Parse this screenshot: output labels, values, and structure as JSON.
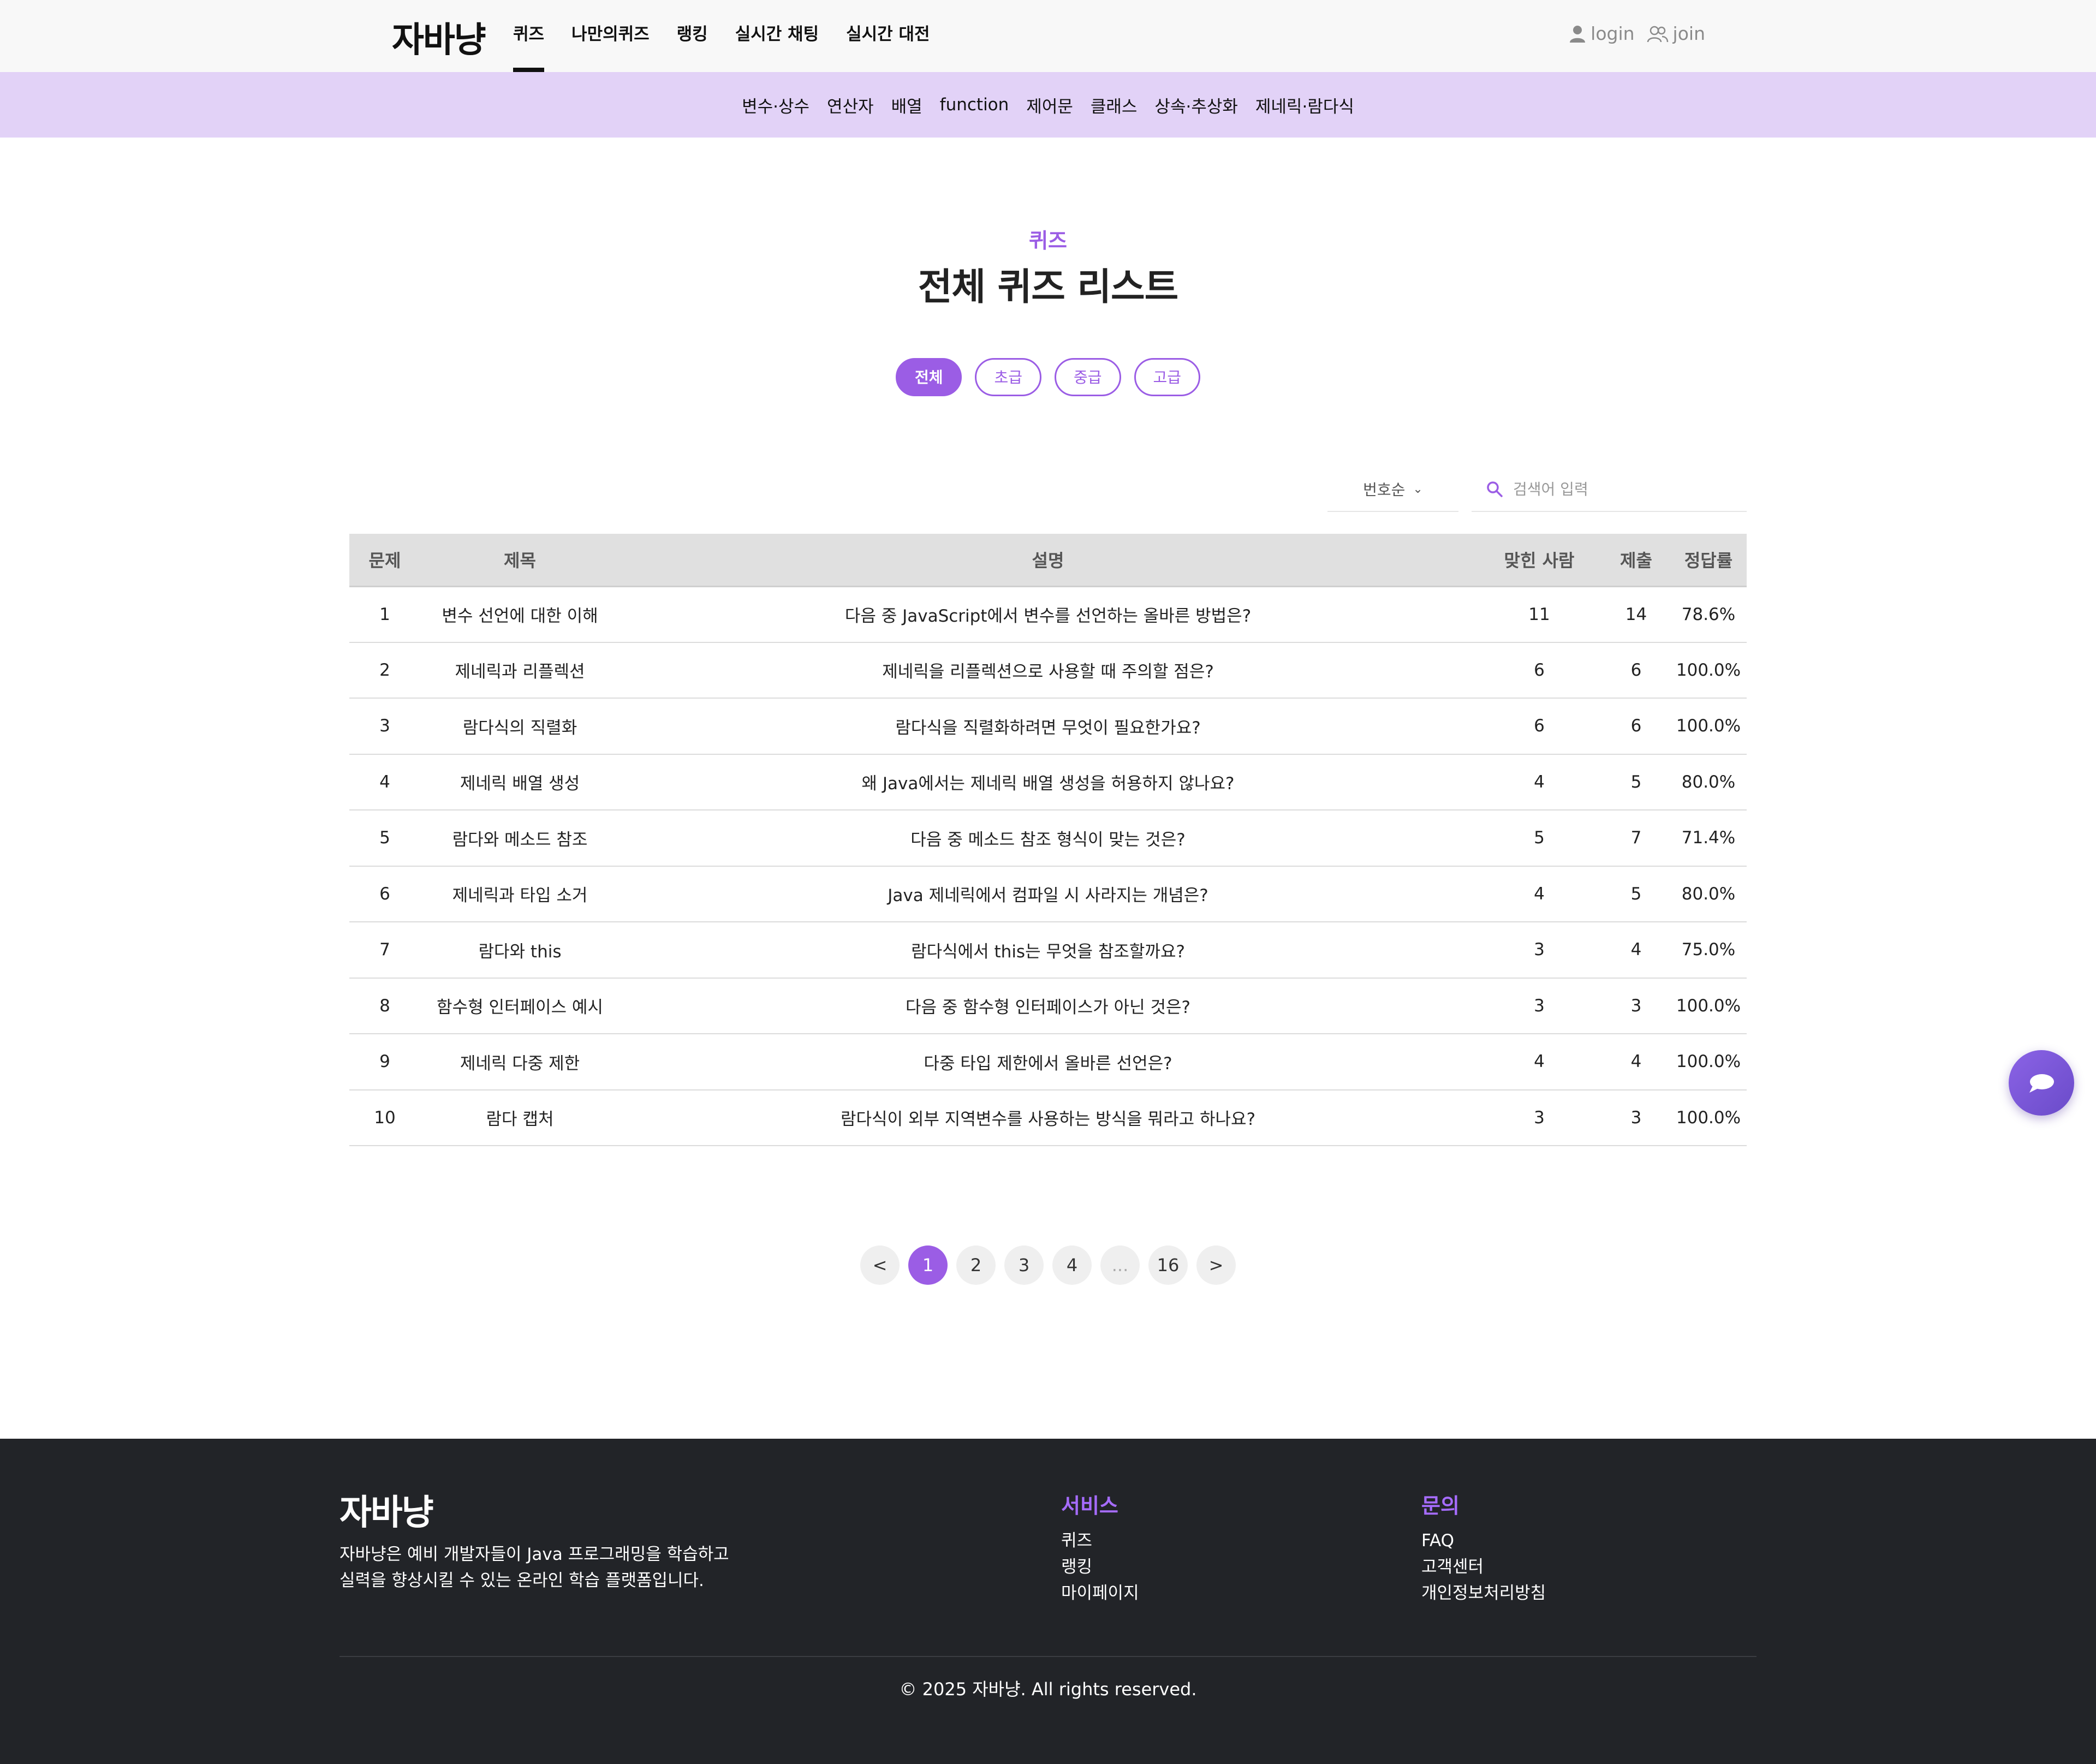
{
  "header": {
    "logo": "자바냥",
    "nav": [
      "퀴즈",
      "나만의퀴즈",
      "랭킹",
      "실시간 채팅",
      "실시간 대전"
    ],
    "login_label": "login",
    "join_label": "join"
  },
  "subnav": [
    "변수·상수",
    "연산자",
    "배열",
    "function",
    "제어문",
    "클래스",
    "상속·추상화",
    "제네릭·람다식"
  ],
  "hero": {
    "eyebrow": "퀴즈",
    "title": "전체 퀴즈 리스트"
  },
  "levels": [
    "전체",
    "초급",
    "중급",
    "고급"
  ],
  "controls": {
    "sort_label": "번호순",
    "search_placeholder": "검색어 입력"
  },
  "table": {
    "headers": [
      "문제",
      "제목",
      "설명",
      "맞힌 사람",
      "제출",
      "정답률"
    ],
    "rows": [
      [
        "1",
        "변수 선언에 대한 이해",
        "다음 중 JavaScript에서 변수를 선언하는 올바른 방법은?",
        "11",
        "14",
        "78.6%"
      ],
      [
        "2",
        "제네릭과 리플렉션",
        "제네릭을 리플렉션으로 사용할 때 주의할 점은?",
        "6",
        "6",
        "100.0%"
      ],
      [
        "3",
        "람다식의 직렬화",
        "람다식을 직렬화하려면 무엇이 필요한가요?",
        "6",
        "6",
        "100.0%"
      ],
      [
        "4",
        "제네릭 배열 생성",
        "왜 Java에서는 제네릭 배열 생성을 허용하지 않나요?",
        "4",
        "5",
        "80.0%"
      ],
      [
        "5",
        "람다와 메소드 참조",
        "다음 중 메소드 참조 형식이 맞는 것은?",
        "5",
        "7",
        "71.4%"
      ],
      [
        "6",
        "제네릭과 타입 소거",
        "Java 제네릭에서 컴파일 시 사라지는 개념은?",
        "4",
        "5",
        "80.0%"
      ],
      [
        "7",
        "람다와 this",
        "람다식에서 this는 무엇을 참조할까요?",
        "3",
        "4",
        "75.0%"
      ],
      [
        "8",
        "함수형 인터페이스 예시",
        "다음 중 함수형 인터페이스가 아닌 것은?",
        "3",
        "3",
        "100.0%"
      ],
      [
        "9",
        "제네릭 다중 제한",
        "다중 타입 제한에서 올바른 선언은?",
        "4",
        "4",
        "100.0%"
      ],
      [
        "10",
        "람다 캡처",
        "람다식이 외부 지역변수를 사용하는 방식을 뭐라고 하나요?",
        "3",
        "3",
        "100.0%"
      ]
    ]
  },
  "pagination": {
    "prev": "<",
    "pages": [
      "1",
      "2",
      "3",
      "4",
      "...",
      "16"
    ],
    "next": ">",
    "current": "1"
  },
  "footer": {
    "logo": "자바냥",
    "desc_line1": "자바냥은 예비 개발자들이 Java 프로그래밍을 학습하고",
    "desc_line2": "실력을 향상시킬 수 있는 온라인 학습 플랫폼입니다.",
    "service_title": "서비스",
    "service_links": [
      "퀴즈",
      "랭킹",
      "마이페이지"
    ],
    "contact_title": "문의",
    "contact_links": [
      "FAQ",
      "고객센터",
      "개인정보처리방침"
    ],
    "copyright": "© 2025 자바냥. All rights reserved."
  },
  "icons": {
    "login": "user-icon",
    "join": "users-icon",
    "search": "search-icon",
    "sort": "chevron-down-icon",
    "chat": "chat-bubble-icon"
  },
  "colors": {
    "accent": "#9b5de5",
    "subnav_bg": "#e2d2f7",
    "footer_bg": "#222428"
  }
}
